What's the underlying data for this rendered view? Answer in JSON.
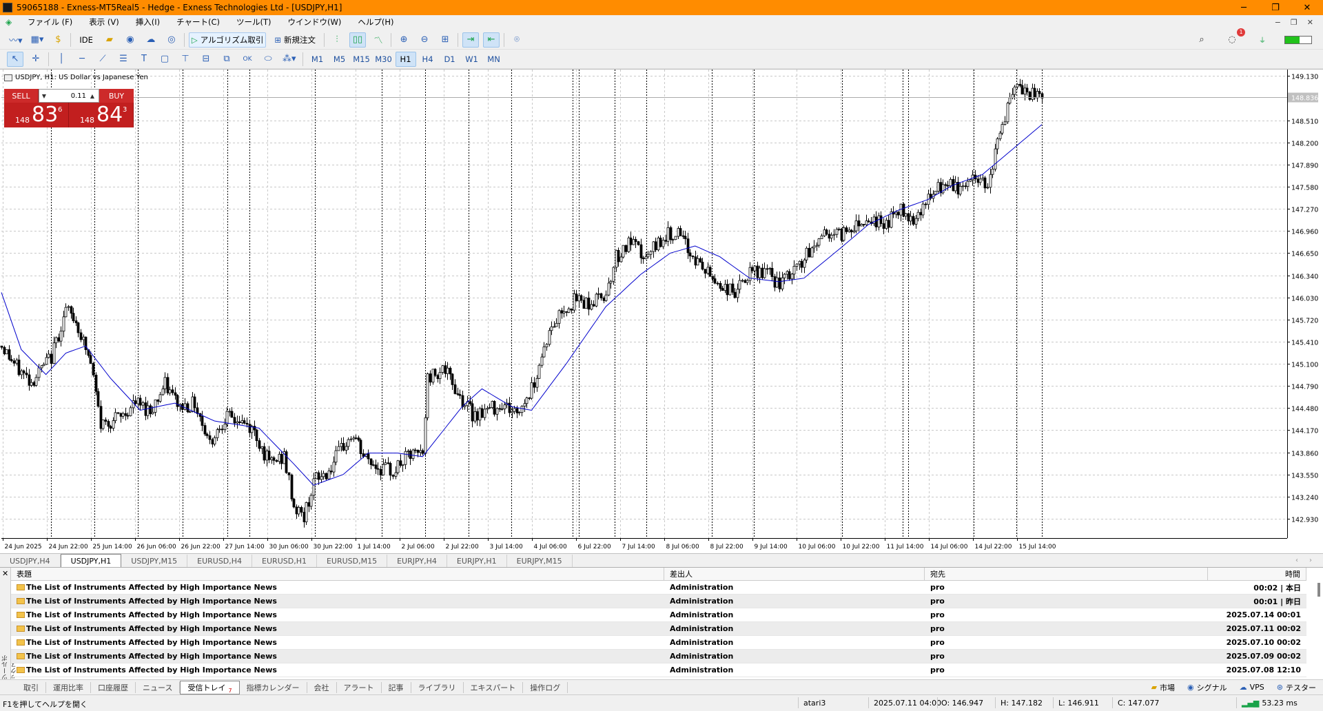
{
  "window": {
    "title": "59065188 - Exness-MT5Real5 - Hedge - Exness Technologies Ltd - [USDJPY,H1]",
    "controls": [
      "─",
      "❐",
      "✕"
    ]
  },
  "menu": {
    "items": [
      "ファイル (F)",
      "表示 (V)",
      "挿入(I)",
      "チャート(C)",
      "ツール(T)",
      "ウインドウ(W)",
      "ヘルプ(H)"
    ],
    "mdi_controls": [
      "−",
      "❐",
      "✕"
    ]
  },
  "toolbar1": {
    "ide_label": "IDE",
    "algo_label": "アルゴリズム取引",
    "new_order_label": "新規注文",
    "badge_count": "1"
  },
  "toolbar2": {
    "timeframes": [
      "M1",
      "M5",
      "M15",
      "M30",
      "H1",
      "H4",
      "D1",
      "W1",
      "MN"
    ],
    "active_timeframe": "H1"
  },
  "chart": {
    "header_text": "USDJPY, H1:  US Dollar vs Japanese Yen",
    "current_price_label": "148.836",
    "colors": {
      "bars": "#000000",
      "ma": "#0000cc",
      "grid": "#c8c8c8",
      "current_line": "#aaaaaa",
      "trade_red": "#c21f1f"
    }
  },
  "trade_panel": {
    "sell_label": "SELL",
    "buy_label": "BUY",
    "lot": "0.11",
    "sell_small": "148",
    "sell_big": "83",
    "sell_sup": "6",
    "buy_small": "148",
    "buy_big": "84",
    "buy_sup": "3"
  },
  "chart_data": {
    "type": "candlestick",
    "symbol": "USDJPY",
    "timeframe": "H1",
    "y_ticks": [
      "149.130",
      "148.510",
      "148.200",
      "147.890",
      "147.580",
      "147.270",
      "146.960",
      "146.650",
      "146.340",
      "146.030",
      "145.720",
      "145.410",
      "145.100",
      "144.790",
      "144.480",
      "144.170",
      "143.860",
      "143.550",
      "143.240",
      "142.930"
    ],
    "ylim": [
      142.66,
      149.22
    ],
    "x_ticks": [
      "24 Jun 2025",
      "24 Jun 22:00",
      "25 Jun 14:00",
      "26 Jun 06:00",
      "26 Jun 22:00",
      "27 Jun 14:00",
      "30 Jun 06:00",
      "30 Jun 22:00",
      "1 Jul 14:00",
      "2 Jul 06:00",
      "2 Jul 22:00",
      "3 Jul 14:00",
      "4 Jul 06:00",
      "6 Jul 22:00",
      "7 Jul 14:00",
      "8 Jul 06:00",
      "8 Jul 22:00",
      "9 Jul 14:00",
      "10 Jul 06:00",
      "10 Jul 22:00",
      "11 Jul 14:00",
      "14 Jul 06:00",
      "14 Jul 22:00",
      "15 Jul 14:00"
    ],
    "close_path": [
      [
        0,
        145.35
      ],
      [
        6,
        145.05
      ],
      [
        12,
        144.85
      ],
      [
        20,
        145.2
      ],
      [
        26,
        145.85
      ],
      [
        30,
        145.7
      ],
      [
        36,
        145.1
      ],
      [
        40,
        144.25
      ],
      [
        48,
        144.35
      ],
      [
        54,
        144.55
      ],
      [
        60,
        144.45
      ],
      [
        66,
        144.8
      ],
      [
        72,
        144.5
      ],
      [
        78,
        144.55
      ],
      [
        84,
        144.0
      ],
      [
        90,
        144.35
      ],
      [
        96,
        144.3
      ],
      [
        102,
        144.15
      ],
      [
        108,
        143.7
      ],
      [
        114,
        143.8
      ],
      [
        118,
        143.1
      ],
      [
        122,
        142.95
      ],
      [
        126,
        143.45
      ],
      [
        132,
        143.6
      ],
      [
        138,
        143.95
      ],
      [
        142,
        144.1
      ],
      [
        146,
        143.8
      ],
      [
        152,
        143.65
      ],
      [
        158,
        143.6
      ],
      [
        164,
        143.8
      ],
      [
        170,
        143.85
      ],
      [
        172,
        144.9
      ],
      [
        178,
        145.05
      ],
      [
        184,
        144.7
      ],
      [
        190,
        144.4
      ],
      [
        196,
        144.45
      ],
      [
        202,
        144.55
      ],
      [
        208,
        144.4
      ],
      [
        214,
        144.75
      ],
      [
        220,
        145.45
      ],
      [
        226,
        145.85
      ],
      [
        232,
        146.0
      ],
      [
        238,
        145.95
      ],
      [
        244,
        146.1
      ],
      [
        248,
        146.6
      ],
      [
        254,
        146.8
      ],
      [
        260,
        146.55
      ],
      [
        266,
        146.85
      ],
      [
        272,
        146.95
      ],
      [
        278,
        146.65
      ],
      [
        284,
        146.4
      ],
      [
        290,
        146.2
      ],
      [
        296,
        146.1
      ],
      [
        302,
        146.35
      ],
      [
        308,
        146.4
      ],
      [
        314,
        146.2
      ],
      [
        320,
        146.4
      ],
      [
        326,
        146.65
      ],
      [
        332,
        146.95
      ],
      [
        338,
        146.9
      ],
      [
        344,
        147.05
      ],
      [
        350,
        147.15
      ],
      [
        356,
        147.05
      ],
      [
        362,
        147.25
      ],
      [
        368,
        147.15
      ],
      [
        374,
        147.4
      ],
      [
        380,
        147.6
      ],
      [
        386,
        147.55
      ],
      [
        392,
        147.7
      ],
      [
        398,
        147.65
      ],
      [
        402,
        148.2
      ],
      [
        406,
        148.7
      ],
      [
        410,
        148.95
      ],
      [
        416,
        148.85
      ],
      [
        420,
        148.84
      ]
    ],
    "ma_path": [
      [
        0,
        146.1
      ],
      [
        8,
        145.3
      ],
      [
        18,
        144.95
      ],
      [
        26,
        145.25
      ],
      [
        34,
        145.35
      ],
      [
        44,
        144.9
      ],
      [
        56,
        144.45
      ],
      [
        70,
        144.55
      ],
      [
        86,
        144.3
      ],
      [
        104,
        144.2
      ],
      [
        118,
        143.7
      ],
      [
        126,
        143.4
      ],
      [
        138,
        143.55
      ],
      [
        148,
        143.85
      ],
      [
        160,
        143.85
      ],
      [
        170,
        143.8
      ],
      [
        186,
        144.5
      ],
      [
        194,
        144.75
      ],
      [
        206,
        144.5
      ],
      [
        214,
        144.45
      ],
      [
        228,
        145.1
      ],
      [
        244,
        145.9
      ],
      [
        258,
        146.35
      ],
      [
        270,
        146.65
      ],
      [
        280,
        146.75
      ],
      [
        290,
        146.6
      ],
      [
        302,
        146.3
      ],
      [
        314,
        146.25
      ],
      [
        324,
        146.3
      ],
      [
        338,
        146.7
      ],
      [
        350,
        147.05
      ],
      [
        362,
        147.25
      ],
      [
        374,
        147.4
      ],
      [
        384,
        147.6
      ],
      [
        396,
        147.75
      ],
      [
        408,
        148.1
      ],
      [
        420,
        148.45
      ]
    ],
    "ma_color": "#0000cc",
    "legend_position": "none"
  },
  "chart_tabs": [
    "USDJPY,H4",
    "USDJPY,H1",
    "USDJPY,M15",
    "EURUSD,H4",
    "EURUSD,H1",
    "EURUSD,M15",
    "EURJPY,H4",
    "EURJPY,H1",
    "EURJPY,M15"
  ],
  "active_chart_tab": "USDJPY,H1",
  "toolbox": {
    "side_label": "ツールボックス",
    "columns": {
      "subject": "表題",
      "from": "差出人",
      "to": "宛先",
      "time": "時間"
    },
    "rows": [
      {
        "subject": "The List of Instruments Affected by High Importance News",
        "from": "Administration",
        "to": "pro",
        "time": "00:02 | 本日"
      },
      {
        "subject": "The List of Instruments Affected by High Importance News",
        "from": "Administration",
        "to": "pro",
        "time": "00:01 | 昨日"
      },
      {
        "subject": "The List of Instruments Affected by High Importance News",
        "from": "Administration",
        "to": "pro",
        "time": "2025.07.14 00:01"
      },
      {
        "subject": "The List of Instruments Affected by High Importance News",
        "from": "Administration",
        "to": "pro",
        "time": "2025.07.11 00:02"
      },
      {
        "subject": "The List of Instruments Affected by High Importance News",
        "from": "Administration",
        "to": "pro",
        "time": "2025.07.10 00:02"
      },
      {
        "subject": "The List of Instruments Affected by High Importance News",
        "from": "Administration",
        "to": "pro",
        "time": "2025.07.09 00:02"
      },
      {
        "subject": "The List of Instruments Affected by High Importance News",
        "from": "Administration",
        "to": "pro",
        "time": "2025.07.08 12:10"
      }
    ]
  },
  "toolbox_tabs": {
    "tabs": [
      "取引",
      "運用比率",
      "口座履歴",
      "ニュース",
      "受信トレイ",
      "指標カレンダー",
      "会社",
      "アラート",
      "記事",
      "ライブラリ",
      "エキスパート",
      "操作ログ"
    ],
    "active": "受信トレイ",
    "inbox_count": "7",
    "right": [
      "市場",
      "シグナル",
      "VPS",
      "テスター"
    ]
  },
  "status": {
    "help": "F1を押してヘルプを開く",
    "profile": "atari3",
    "datetime": "2025.07.11 04:00",
    "open": "O: 146.947",
    "high": "H: 147.182",
    "low": "L: 146.911",
    "close": "C: 147.077",
    "ping": "53.23 ms",
    "signal_fill_pct": 55
  }
}
